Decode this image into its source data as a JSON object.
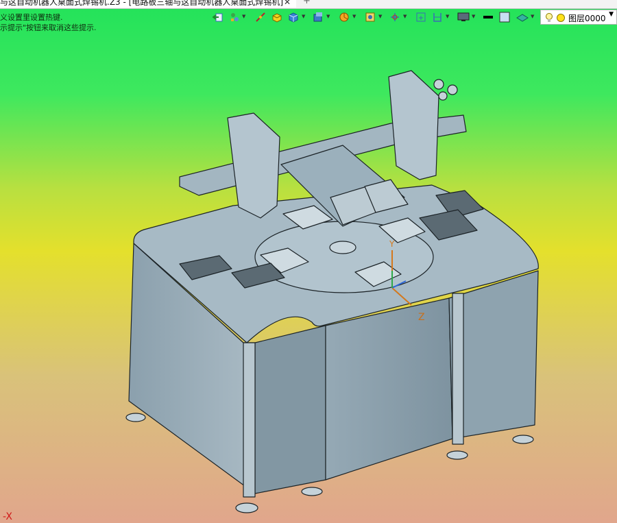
{
  "window": {
    "tab_title": "与这自动机器人桌面式焊锡机.Z3 - [电路板三轴与这自动机器人桌面式焊锡机]",
    "tab_close": "✕",
    "tab_plus": "+"
  },
  "hints": [
    "义设置里设置热键.",
    "示提示\"按钮来取消这些提示."
  ],
  "toolbar": {
    "layer_name": "图层0000",
    "icons": [
      "exit-icon",
      "tree-icon",
      "line-icon",
      "box-icon",
      "cube-icon",
      "render-cube-icon",
      "pie-icon",
      "visibility-icon",
      "axis-icon",
      "grid-icon",
      "ruler-icon",
      "monitor-icon",
      "black-bar-icon",
      "square-icon",
      "plane-icon"
    ]
  },
  "axes": {
    "x_label": "-X",
    "y_label": "Y",
    "z_label": "Z"
  },
  "colors": {
    "bg_top": "#22e25a",
    "bg_mid": "#e4e02c",
    "bg_bottom": "#e1a68c",
    "model": "#9fb2be"
  }
}
